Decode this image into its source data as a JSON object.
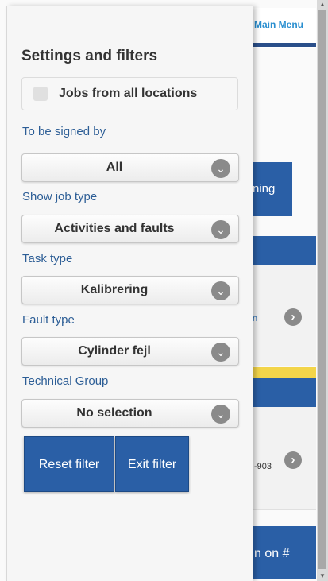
{
  "background": {
    "main_menu_label": "Main Menu",
    "button_partial": "ning",
    "card_a_partial": "n",
    "card_b_partial": "-903",
    "bottom_button_partial": "n on #",
    "chevron_glyph": "›",
    "accent": "#2a5fa6",
    "highlight": "#f3d54a"
  },
  "panel": {
    "title": "Settings and filters",
    "all_locations": {
      "label": "Jobs from all locations",
      "checked": false
    },
    "filters": [
      {
        "label": "To be signed by",
        "value": "All"
      },
      {
        "label": "Show job type",
        "value": "Activities and faults"
      },
      {
        "label": "Task type",
        "value": "Kalibrering"
      },
      {
        "label": "Fault type",
        "value": "Cylinder fejl"
      },
      {
        "label": "Technical Group",
        "value": "No selection"
      }
    ],
    "chevron_glyph": "⌄",
    "buttons": {
      "reset": "Reset filter",
      "exit": "Exit filter"
    },
    "label_color": "#2d5e96"
  },
  "scrollbar": {
    "up_glyph": "▲",
    "down_glyph": "▼"
  }
}
